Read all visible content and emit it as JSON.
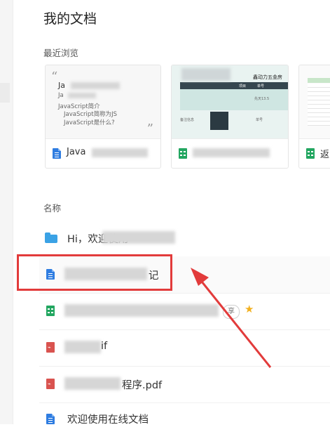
{
  "page": {
    "title": "我的文档"
  },
  "recent": {
    "label": "最近浏览",
    "cards": [
      {
        "name_visible": "Java",
        "preview_lines": [
          "Ja",
          "Ja",
          "JavaScript简介",
          "JavaScript简称为JS",
          "JavaScript是什么?"
        ]
      },
      {
        "name_visible": "",
        "preview_heading": "鑫动力五金房",
        "preview_cells": [
          "项目",
          "单号",
          "先天13.5",
          "备注信息",
          "单号"
        ]
      },
      {
        "name_visible": "返"
      }
    ]
  },
  "list": {
    "label": "名称",
    "items": [
      {
        "type": "folder",
        "name_visible": "Hi，欢迎使用"
      },
      {
        "type": "doc",
        "name_visible": "记",
        "highlighted": true
      },
      {
        "type": "sheet",
        "name_visible": "",
        "share": "享",
        "starred": true
      },
      {
        "type": "pdf",
        "name_visible": "if"
      },
      {
        "type": "pdf",
        "name_visible": "程序.pdf"
      },
      {
        "type": "doc",
        "name_visible": "欢迎使用在线文档"
      }
    ]
  },
  "colors": {
    "annotation": "#e23b3b",
    "doc": "#2f7de1",
    "sheet": "#22a660",
    "pdf": "#d9534f",
    "folder": "#3aa2e5",
    "star": "#f2b01e"
  }
}
